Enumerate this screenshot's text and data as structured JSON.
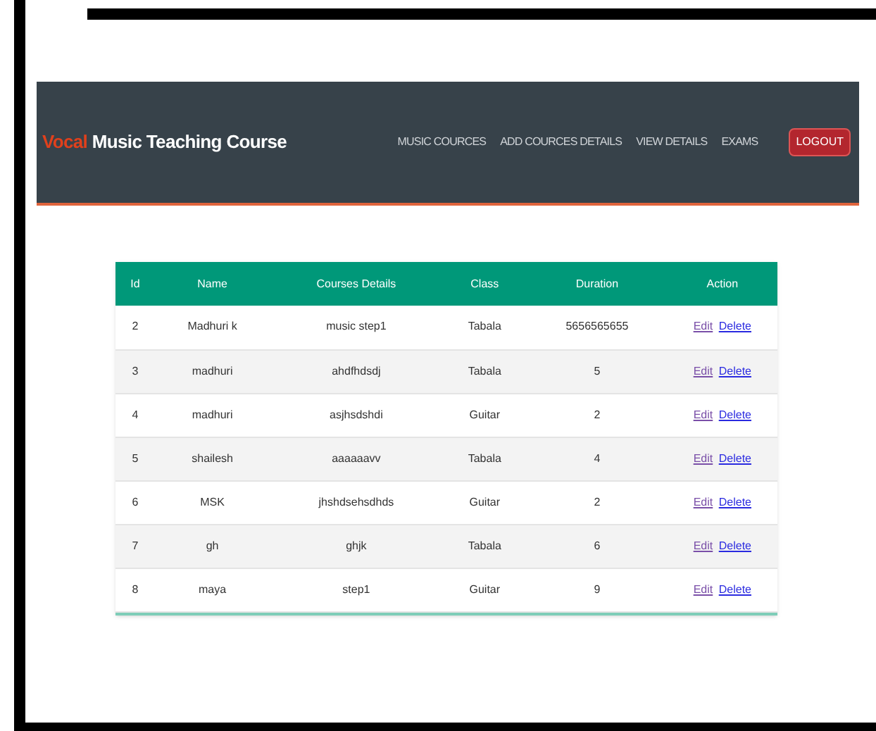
{
  "brand": {
    "accent": "Vocal",
    "rest": "Music Teaching Course"
  },
  "nav": [
    {
      "label": "MUSIC COURCES"
    },
    {
      "label": "ADD COURCES DETAILS"
    },
    {
      "label": "VIEW DETAILS"
    },
    {
      "label": "EXAMS"
    }
  ],
  "logout": "LOGOUT",
  "table": {
    "columns": [
      "Id",
      "Name",
      "Courses Details",
      "Class",
      "Duration",
      "Action"
    ],
    "rows": [
      {
        "id": "2",
        "name": "Madhuri k",
        "details": "music step1",
        "class": "Tabala",
        "duration": "5656565655",
        "edit": "Edit",
        "delete": "Delete",
        "edit_visited": true
      },
      {
        "id": "3",
        "name": "madhuri",
        "details": "ahdfhdsdj",
        "class": "Tabala",
        "duration": "5",
        "edit": "Edit",
        "delete": "Delete",
        "edit_visited": true
      },
      {
        "id": "4",
        "name": "madhuri",
        "details": "asjhsdshdi",
        "class": "Guitar",
        "duration": "2",
        "edit": "Edit",
        "delete": "Delete",
        "edit_visited": true
      },
      {
        "id": "5",
        "name": "shailesh",
        "details": "aaaaaavv",
        "class": "Tabala",
        "duration": "4",
        "edit": "Edit",
        "delete": "Delete",
        "edit_visited": true
      },
      {
        "id": "6",
        "name": "MSK",
        "details": "jhshdsehsdhds",
        "class": "Guitar",
        "duration": "2",
        "edit": "Edit",
        "delete": "Delete",
        "edit_visited": true
      },
      {
        "id": "7",
        "name": "gh",
        "details": "ghjk",
        "class": "Tabala",
        "duration": "6",
        "edit": "Edit",
        "delete": "Delete",
        "edit_visited": true
      },
      {
        "id": "8",
        "name": "maya",
        "details": "step1",
        "class": "Guitar",
        "duration": "9",
        "edit": "Edit",
        "delete": "Delete",
        "edit_visited": true
      }
    ]
  }
}
